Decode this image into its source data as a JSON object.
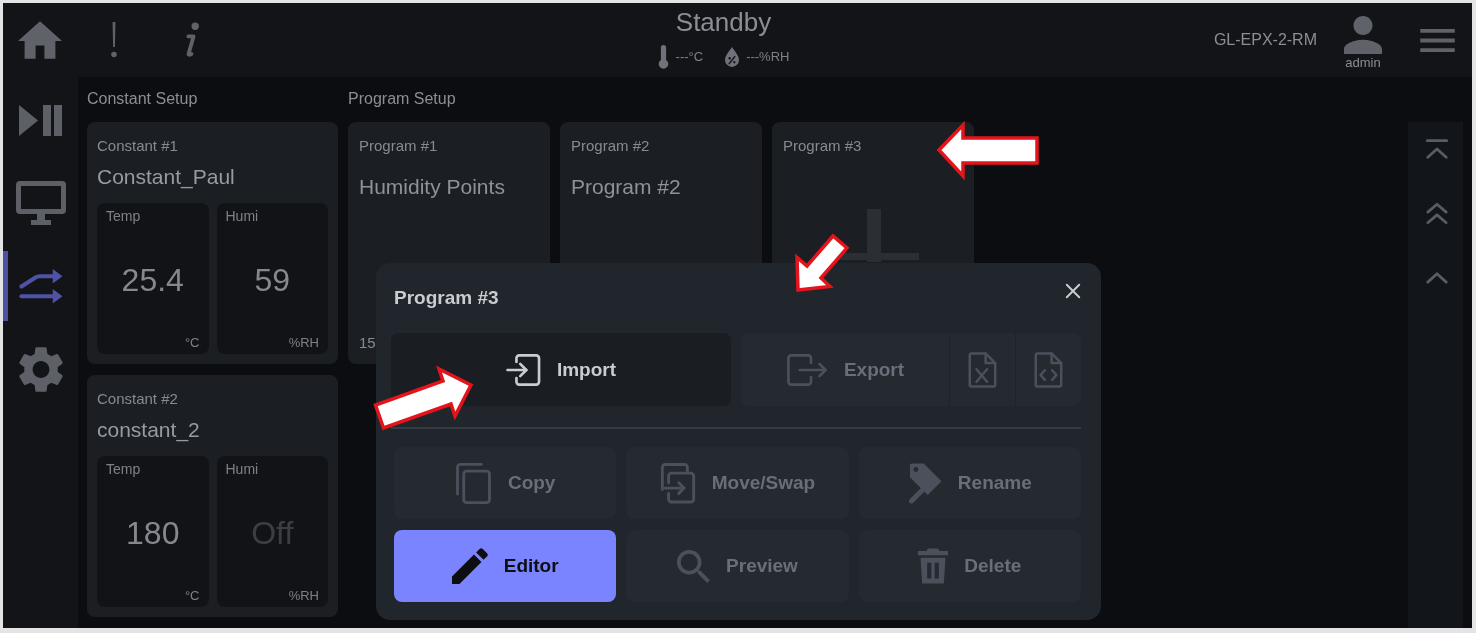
{
  "top_bar": {
    "status": "Standby",
    "temperature": "---°C",
    "humidity": "---%RH",
    "device": "GL-EPX-2-RM",
    "user": "admin"
  },
  "sidebar": {
    "items": [
      {
        "selected": false
      },
      {
        "selected": false
      },
      {
        "selected": true
      },
      {
        "selected": false
      }
    ]
  },
  "constant_setup": {
    "heading": "Constant Setup",
    "cards": [
      {
        "label": "Constant #1",
        "name": "Constant_Paul",
        "readings": [
          {
            "label": "Temp",
            "value": "25.4",
            "unit": "°C",
            "active": true
          },
          {
            "label": "Humi",
            "value": "59",
            "unit": "%RH",
            "active": true
          }
        ]
      },
      {
        "label": "Constant #2",
        "name": "constant_2",
        "readings": [
          {
            "label": "Temp",
            "value": "180",
            "unit": "°C",
            "active": true
          },
          {
            "label": "Humi",
            "value": "Off",
            "unit": "%RH",
            "active": false
          }
        ]
      }
    ]
  },
  "program_setup": {
    "heading": "Program Setup",
    "cards": [
      {
        "label": "Program #1",
        "name": "Humidity Points",
        "footer": "15",
        "empty": false
      },
      {
        "label": "Program #2",
        "name": "Program #2",
        "empty": false
      },
      {
        "label": "Program #3",
        "empty": true
      }
    ]
  },
  "dialog": {
    "title": "Program #3",
    "import": {
      "label": "Import",
      "disabled": false
    },
    "export": {
      "label": "Export",
      "disabled": true,
      "formats": [
        {
          "disabled": true
        },
        {
          "disabled": true
        }
      ]
    },
    "actions": [
      {
        "label": "Copy",
        "disabled": true,
        "primary": false
      },
      {
        "label": "Move/Swap",
        "disabled": true,
        "primary": false
      },
      {
        "label": "Rename",
        "disabled": true,
        "primary": false
      },
      {
        "label": "Editor",
        "disabled": false,
        "primary": true
      },
      {
        "label": "Preview",
        "disabled": true,
        "primary": false
      },
      {
        "label": "Delete",
        "disabled": true,
        "primary": false
      }
    ]
  },
  "annotations": [
    {
      "kind": "arrow"
    },
    {
      "kind": "arrow"
    },
    {
      "kind": "arrow"
    }
  ]
}
